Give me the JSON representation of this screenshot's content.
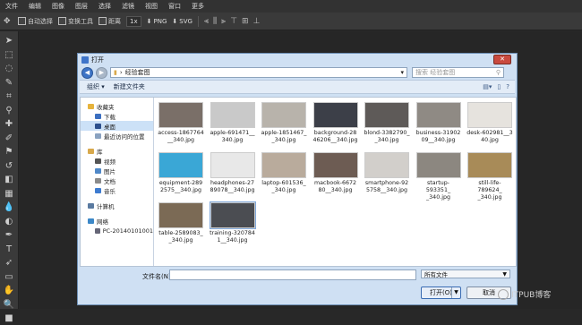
{
  "menubar": [
    "文件",
    "编辑",
    "图像",
    "图层",
    "选择",
    "滤镜",
    "视图",
    "窗口",
    "更多"
  ],
  "options": {
    "auto_select": "自动选择",
    "transform": "变换工具",
    "distance": "距离",
    "zoom": "1x",
    "png": "PNG",
    "svg": "SVG"
  },
  "dialog": {
    "title": "打开",
    "address": "经验套图",
    "search_placeholder": "搜索 经验套图",
    "organize": "组织 ▾",
    "new_folder": "新建文件夹",
    "file_name_label": "文件名(N):",
    "file_type": "所有文件",
    "open_button": "打开(O)",
    "cancel_button": "取消"
  },
  "nav_pane": [
    {
      "label": "收藏夹",
      "sub": false,
      "color": "#e6b33c"
    },
    {
      "label": "下载",
      "sub": true,
      "color": "#3c6fc0"
    },
    {
      "label": "桌面",
      "sub": true,
      "color": "#2c4f8c",
      "selected": true
    },
    {
      "label": "最近访问的位置",
      "sub": true,
      "color": "#8aa2c0"
    },
    {
      "label": "",
      "gap": true
    },
    {
      "label": "库",
      "sub": false,
      "color": "#d8a94c"
    },
    {
      "label": "视频",
      "sub": true,
      "color": "#555"
    },
    {
      "label": "图片",
      "sub": true,
      "color": "#4f88c8"
    },
    {
      "label": "文档",
      "sub": true,
      "color": "#8b8b8b"
    },
    {
      "label": "音乐",
      "sub": true,
      "color": "#3d7bd0"
    },
    {
      "label": "",
      "gap": true
    },
    {
      "label": "计算机",
      "sub": false,
      "color": "#5a7aa0"
    },
    {
      "label": "",
      "gap": true
    },
    {
      "label": "网络",
      "sub": false,
      "color": "#3c88c8"
    },
    {
      "label": "PC-20140101001",
      "sub": true,
      "color": "#667"
    }
  ],
  "files": [
    {
      "name": "access-1867764_340.jpg",
      "line1": "access-1867764",
      "line2": "__340.jpg",
      "color": "#7a6f68"
    },
    {
      "name": "apple-691471__340.jpg",
      "line1": "apple-691471__",
      "line2": "340.jpg",
      "color": "#c9c9c9"
    },
    {
      "name": "apple-1851467__340.jpg",
      "line1": "apple-1851467_",
      "line2": "_340.jpg",
      "color": "#b8b3ab"
    },
    {
      "name": "background-2846206__340.jpg",
      "line1": "background-28",
      "line2": "46206__340.jpg",
      "color": "#3c3f48"
    },
    {
      "name": "blond-3382790__340.jpg",
      "line1": "blond-3382790_",
      "line2": "_340.jpg",
      "color": "#5e5a58"
    },
    {
      "name": "business-3190209__340.jpg",
      "line1": "business-31902",
      "line2": "09__340.jpg",
      "color": "#8f8a84"
    },
    {
      "name": "desk-602981__340.jpg",
      "line1": "desk-602981__3",
      "line2": "40.jpg",
      "color": "#e6e3de"
    },
    {
      "name": "equipment-2892575__340.jpg",
      "line1": "equipment-289",
      "line2": "2575__340.jpg",
      "color": "#3aa7d6"
    },
    {
      "name": "headphones-2789078__340.jpg",
      "line1": "headphones-27",
      "line2": "89078__340.jpg",
      "color": "#e8e8e8"
    },
    {
      "name": "laptop-601536__340.jpg",
      "line1": "laptop-601536_",
      "line2": "_340.jpg",
      "color": "#b9ab9c"
    },
    {
      "name": "macbook-667280__340.jpg",
      "line1": "macbook-6672",
      "line2": "80__340.jpg",
      "color": "#6d5c53"
    },
    {
      "name": "smartphone-925758__340.jpg",
      "line1": "smartphone-92",
      "line2": "5758__340.jpg",
      "color": "#d2cfcb"
    },
    {
      "name": "startup-593351__340.jpg",
      "line1": "startup-593351_",
      "line2": "_340.jpg",
      "color": "#8c8780"
    },
    {
      "name": "still-life-789624__340.jpg",
      "line1": "still-life-789624_",
      "line2": "_340.jpg",
      "color": "#a88b58"
    },
    {
      "name": "table-2589083__340.jpg",
      "line1": "table-2589083_",
      "line2": "_340.jpg",
      "color": "#7b6a55"
    },
    {
      "name": "training-3207841__340.jpg",
      "line1": "training-320784",
      "line2": "1__340.jpg",
      "color": "#4b4d52",
      "selected": true
    }
  ],
  "watermark": "ITPUB博客"
}
